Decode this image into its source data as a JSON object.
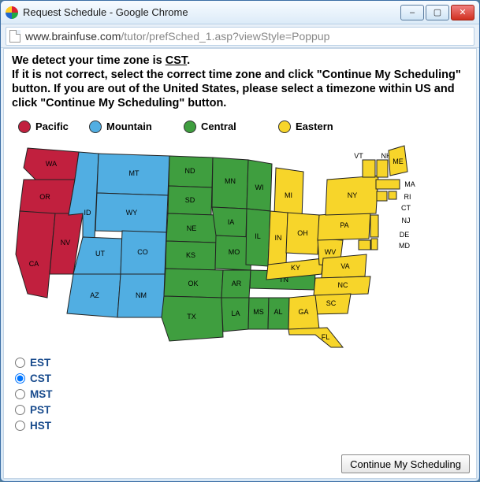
{
  "window": {
    "title": "Request Schedule - Google Chrome",
    "min_label": "–",
    "max_label": "▢",
    "close_label": "✕"
  },
  "address": {
    "host": "www.brainfuse.com",
    "path": "/tutor/prefSched_1.asp?viewStyle=Poppup"
  },
  "instructions": {
    "line1_prefix": "We detect your time zone is ",
    "detected_tz": "CST",
    "line1_suffix": ".",
    "body": "If it is not correct, select the correct time zone and click \"Continue My Scheduling\" button. If you are out of the United States, please select a timezone within US and click \"Continue My Scheduling\" button."
  },
  "legend": {
    "pacific": {
      "label": "Pacific",
      "color": "#c1203e"
    },
    "mountain": {
      "label": "Mountain",
      "color": "#51aee2"
    },
    "central": {
      "label": "Central",
      "color": "#3f9e3f"
    },
    "eastern": {
      "label": "Eastern",
      "color": "#f7d52a"
    }
  },
  "map": {
    "states": [
      {
        "code": "WA",
        "zone": "p"
      },
      {
        "code": "OR",
        "zone": "p"
      },
      {
        "code": "CA",
        "zone": "p"
      },
      {
        "code": "NV",
        "zone": "p"
      },
      {
        "code": "ID",
        "zone": "m"
      },
      {
        "code": "MT",
        "zone": "m"
      },
      {
        "code": "WY",
        "zone": "m"
      },
      {
        "code": "UT",
        "zone": "m"
      },
      {
        "code": "CO",
        "zone": "m"
      },
      {
        "code": "AZ",
        "zone": "m"
      },
      {
        "code": "NM",
        "zone": "m"
      },
      {
        "code": "ND",
        "zone": "c"
      },
      {
        "code": "SD",
        "zone": "c"
      },
      {
        "code": "NE",
        "zone": "c"
      },
      {
        "code": "KS",
        "zone": "c"
      },
      {
        "code": "OK",
        "zone": "c"
      },
      {
        "code": "TX",
        "zone": "c"
      },
      {
        "code": "MN",
        "zone": "c"
      },
      {
        "code": "IA",
        "zone": "c"
      },
      {
        "code": "MO",
        "zone": "c"
      },
      {
        "code": "AR",
        "zone": "c"
      },
      {
        "code": "LA",
        "zone": "c"
      },
      {
        "code": "WI",
        "zone": "c"
      },
      {
        "code": "IL",
        "zone": "c"
      },
      {
        "code": "MS",
        "zone": "c"
      },
      {
        "code": "AL",
        "zone": "c"
      },
      {
        "code": "TN",
        "zone": "c"
      },
      {
        "code": "MI",
        "zone": "e"
      },
      {
        "code": "IN",
        "zone": "e"
      },
      {
        "code": "OH",
        "zone": "e"
      },
      {
        "code": "KY",
        "zone": "e"
      },
      {
        "code": "WV",
        "zone": "e"
      },
      {
        "code": "VA",
        "zone": "e"
      },
      {
        "code": "NC",
        "zone": "e"
      },
      {
        "code": "SC",
        "zone": "e"
      },
      {
        "code": "GA",
        "zone": "e"
      },
      {
        "code": "FL",
        "zone": "e"
      },
      {
        "code": "PA",
        "zone": "e"
      },
      {
        "code": "NY",
        "zone": "e"
      },
      {
        "code": "VT",
        "zone": "e"
      },
      {
        "code": "NH",
        "zone": "e"
      },
      {
        "code": "ME",
        "zone": "e"
      },
      {
        "code": "MA",
        "zone": "e"
      },
      {
        "code": "RI",
        "zone": "e"
      },
      {
        "code": "CT",
        "zone": "e"
      },
      {
        "code": "NJ",
        "zone": "e"
      },
      {
        "code": "DE",
        "zone": "e"
      },
      {
        "code": "MD",
        "zone": "e"
      }
    ]
  },
  "options": [
    {
      "value": "EST",
      "label": "EST",
      "selected": false
    },
    {
      "value": "CST",
      "label": "CST",
      "selected": true
    },
    {
      "value": "MST",
      "label": "MST",
      "selected": false
    },
    {
      "value": "PST",
      "label": "PST",
      "selected": false
    },
    {
      "value": "HST",
      "label": "HST",
      "selected": false
    }
  ],
  "buttons": {
    "continue": "Continue My Scheduling"
  }
}
